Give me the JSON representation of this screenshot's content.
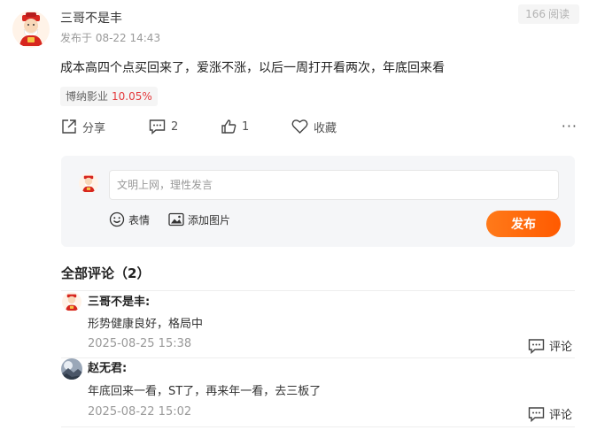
{
  "post": {
    "author": "三哥不是丰",
    "time": "发布于 08-22 14:43",
    "views_count": "166",
    "views_label": "阅读",
    "content": "成本高四个点买回来了，爱涨不涨，以后一周打开看两次，年底回来看",
    "stock": {
      "name": "博纳影业",
      "change": "10.05%"
    }
  },
  "actions": {
    "share_label": "分享",
    "comment_count": "2",
    "like_count": "1",
    "favorite_label": "收藏",
    "more_label": "···"
  },
  "comment_box": {
    "placeholder": "文明上网，理性发言",
    "emoji_label": "表情",
    "image_label": "添加图片",
    "publish_label": "发布"
  },
  "comments_section": {
    "title": "全部评论（2）",
    "items": [
      {
        "author": "三哥不是丰:",
        "text": "形势健康良好，格局中",
        "time": "2025-08-25 15:38",
        "reply_label": "评论"
      },
      {
        "author": "赵无君:",
        "text": "年底回来一看，ST了，再来年一看，去三板了",
        "time": "2025-08-22 15:02",
        "reply_label": "评论"
      }
    ]
  },
  "colors": {
    "accent": "#ff6a00",
    "rise": "#e4393c"
  },
  "icons": [
    "fortune-god-avatar",
    "share-icon",
    "comment-icon",
    "like-icon",
    "heart-icon",
    "more-icon",
    "emoji-icon",
    "image-icon",
    "landscape-avatar"
  ]
}
